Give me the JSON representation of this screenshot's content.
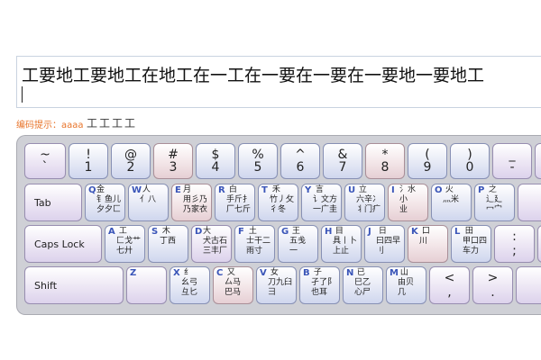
{
  "input": {
    "typed_text": "工要地工要地工在地工在一工在一要在一要在一要地一要地工"
  },
  "hint": {
    "label": "编码提示：aaaa",
    "code": "工工工工"
  },
  "keys": {
    "row1": [
      {
        "shift": "~",
        "main": "`",
        "color": "purple"
      },
      {
        "shift": "!",
        "main": "1",
        "color": "blue"
      },
      {
        "shift": "@",
        "main": "2",
        "color": "blue"
      },
      {
        "shift": "#",
        "main": "3",
        "color": "pink"
      },
      {
        "shift": "$",
        "main": "4",
        "color": "blue"
      },
      {
        "shift": "%",
        "main": "5",
        "color": "blue"
      },
      {
        "shift": "^",
        "main": "6",
        "color": "blue"
      },
      {
        "shift": "&",
        "main": "7",
        "color": "blue"
      },
      {
        "shift": "*",
        "main": "8",
        "color": "pink"
      },
      {
        "shift": "(",
        "main": "9",
        "color": "blue"
      },
      {
        "shift": ")",
        "main": "0",
        "color": "blue"
      },
      {
        "shift": "_",
        "main": "-",
        "color": "purple"
      }
    ],
    "tab": {
      "label": "Tab"
    },
    "row2": [
      {
        "letter": "Q",
        "glyph": "金\n钅鱼儿\n夕夕匚",
        "color": "blue"
      },
      {
        "letter": "W",
        "glyph": " 人\n亻八",
        "color": "blue"
      },
      {
        "letter": "E",
        "glyph": "月\n用彡乃\n乃家衣",
        "color": "pink"
      },
      {
        "letter": "R",
        "glyph": " 白\n手斤扌\n厂七斤",
        "color": "blue"
      },
      {
        "letter": "T",
        "glyph": " 禾\n竹丿攵\n彳冬",
        "color": "blue"
      },
      {
        "letter": "Y",
        "glyph": " 言\n讠文方\n一广圭",
        "color": "blue"
      },
      {
        "letter": "U",
        "glyph": " 立\n六辛冫\n丬门疒",
        "color": "blue"
      },
      {
        "letter": "I",
        "glyph": "氵水\n小\n业",
        "color": "pink"
      },
      {
        "letter": "O",
        "glyph": " 火\n灬米\n",
        "color": "blue"
      },
      {
        "letter": "P",
        "glyph": " 之\n辶廴\n冖宀",
        "color": "blue"
      }
    ],
    "caps": {
      "label": "Caps Lock"
    },
    "row3": [
      {
        "letter": "A",
        "glyph": " 工\n匚戈艹\n七廾",
        "color": "blue"
      },
      {
        "letter": "S",
        "glyph": " 木\n丁西",
        "color": "blue"
      },
      {
        "letter": "D",
        "glyph": "大\n犬古石\n三丰厂",
        "color": "purple"
      },
      {
        "letter": "F",
        "glyph": " 土\n士干二\n雨寸",
        "color": "blue"
      },
      {
        "letter": "G",
        "glyph": " 王\n五戋\n一",
        "color": "blue"
      },
      {
        "letter": "H",
        "glyph": " 目\n具丨卜\n上止",
        "color": "blue"
      },
      {
        "letter": "J",
        "glyph": " 日\n曰四早\n刂",
        "color": "blue"
      },
      {
        "letter": "K",
        "glyph": " 口\n川",
        "color": "pink"
      },
      {
        "letter": "L",
        "glyph": " 田\n甲口四\n车力",
        "color": "blue"
      }
    ],
    "row3_extra": {
      "shift": ":",
      "main": ";"
    },
    "shift": {
      "label": "Shift"
    },
    "row4": [
      {
        "letter": "Z",
        "glyph": "",
        "color": "purple"
      },
      {
        "letter": "X",
        "glyph": " 纟\n幺弓\n彑匕",
        "color": "blue"
      },
      {
        "letter": "C",
        "glyph": " 又\n厶马\n巴马",
        "color": "pink"
      },
      {
        "letter": "V",
        "glyph": " 女\n刀九臼\n彐",
        "color": "blue"
      },
      {
        "letter": "B",
        "glyph": " 子\n孑了阝\n也耳",
        "color": "blue"
      },
      {
        "letter": "N",
        "glyph": " 已\n巳乙\n心尸",
        "color": "blue"
      },
      {
        "letter": "M",
        "glyph": " 山\n由贝\n几",
        "color": "blue"
      }
    ],
    "row4_extra": [
      {
        "shift": "<",
        "main": ","
      },
      {
        "shift": ">",
        "main": "."
      }
    ]
  }
}
